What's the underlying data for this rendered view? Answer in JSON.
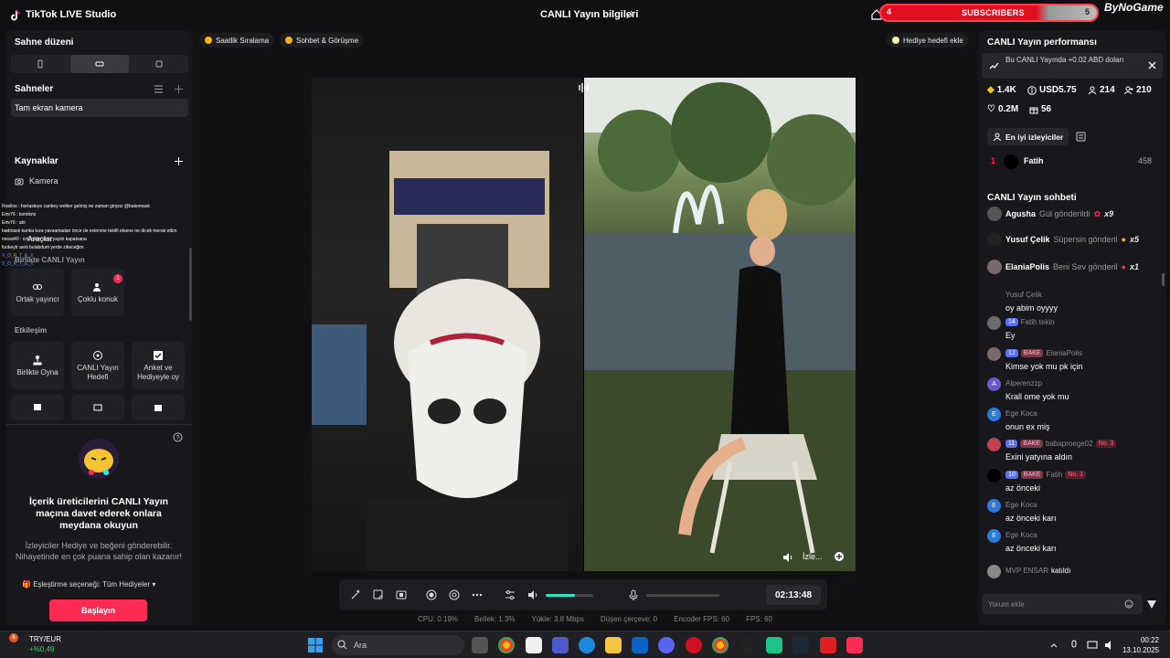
{
  "titlebar": {
    "app_name": "TikTok LIVE Studio",
    "center_title": "CANLI Yayın bilgileri",
    "subscribers_label": "SUBSCRIBERS",
    "subscribers_left": "4",
    "subscribers_right": "5",
    "brand": "ByNoGame"
  },
  "left": {
    "scene_layout_title": "Sahne düzeni",
    "scenes_title": "Sahneler",
    "scene_item": "Tam ekran kamera",
    "sources_title": "Kaynaklar",
    "source_item": "Kamera",
    "overlay_chat": [
      "Roelins : hortasteye canbey wolker gelmiş ne zaman giriyoz @bakemask",
      "Emr76 : komikmi",
      "Emr76 : abi",
      "badmask kanka kıza yavsamadan önce de evlenme teklifi etsene ne dicek merak ettim",
      "messi40 : cok iyisin emir yayini kapatsana",
      "funkeytr aeni bulabdum yerde zikeceğim",
      "V_O_R_T_E_X",
      "V_O_R_T_E_X"
    ],
    "tools_title": "Araçlar",
    "tool_birlikte": "Birlikte CANLI Yayın",
    "tool_partner": "Ortak yayıncı",
    "tool_guests": "Çoklu konuk",
    "guests_badge": "1",
    "interaction_title": "Etkileşim",
    "tool_play": "Birlikte Oyna",
    "tool_goal": "CANLI Yayın Hedefi",
    "tool_poll": "Anket ve Hediyeyle oy",
    "promo_title": "İçerik üreticilerini CANLI Yayın maçına davet ederek onlara meydana okuyun",
    "promo_body": "İzleyiciler Hediye ve beğeni gönderebilir. Nihayetinde en çok puana sahip olan kazanır!",
    "promo_option": "Eşleştirme seçeneği: Tüm Hediyeler",
    "start_button": "Başlayın"
  },
  "center": {
    "chip_hourly": "Saatlik Sıralama",
    "chip_chat": "Sohbet & Görüşme",
    "chip_gift_goal": "Hediye hedefi ekle",
    "watch_label": "İzle...",
    "timer": "02:13:48",
    "volume_level": 0.62,
    "stats": {
      "cpu": "CPU: 0.19%",
      "memory": "Bellek: 1.3%",
      "upload": "Yükle: 3.8 Mbps",
      "dropped": "Düşen çerçeve: 0",
      "encoder_fps": "Encoder FPS: 60",
      "fps": "FPS: 60"
    }
  },
  "right": {
    "perf_title": "CANLI Yayın performansı",
    "perf_note": "Bu CANLI Yayında +0.02 ABD doları",
    "kpi_diamonds": "1.4K",
    "kpi_usd": "USD5.75",
    "kpi_viewers": "214",
    "kpi_followers": "210",
    "kpi_likes": "0.2M",
    "kpi_gifts": "56",
    "top_viewers_btn": "En iyi izleyiciler",
    "rank_no": "1",
    "rank_name": "Fatih",
    "rank_score": "458",
    "chat_title": "CANLI Yayın sohbeti",
    "gifts": [
      {
        "name": "Agusha",
        "text": "Gül gönderildi",
        "count": "x9"
      },
      {
        "name": "Yusuf Çelik",
        "text": "Süpersin gönderil",
        "count": "x5"
      },
      {
        "name": "ElaniaPolis",
        "text": "Beni Sev gönderil",
        "count": "x1"
      }
    ],
    "messages": [
      {
        "name": "Yusuf Çelik",
        "text": "oy abim oyyyy"
      },
      {
        "level": "14",
        "name": "Fatih tekin",
        "text": "Ey"
      },
      {
        "level": "12",
        "tag": "BAKE",
        "name": "ElaniaPolis",
        "text": "Kimse yok mu pk için"
      },
      {
        "name": "Alperenzzp",
        "text": "Krall ome yok mu",
        "initial": "A"
      },
      {
        "name": "Ege Koca",
        "text": "onun ex miş",
        "initial": "E"
      },
      {
        "level": "11",
        "tag": "BAKE",
        "name": "babaproege02",
        "rank": "No. 3",
        "text": "Exini yatyına aldın"
      },
      {
        "level": "10",
        "tag": "BAKE",
        "name": "Fatih",
        "rank": "No. 1",
        "text": "az önceki"
      },
      {
        "name": "Ege Koca",
        "text": "az önceki karı",
        "initial": "E"
      },
      {
        "name": "Ege Koca",
        "text": "az önceki karı",
        "initial": "E"
      }
    ],
    "joined_name": "MVP ENSAR",
    "joined_text": "katıldı",
    "comment_placeholder": "Yorum ekle"
  },
  "taskbar": {
    "stock_name": "TRY/EUR",
    "stock_change": "+%0,49",
    "stock_badge": "6",
    "search_placeholder": "Ara",
    "time": "00:22",
    "date": "13.10.2025"
  },
  "colors": {
    "accent": "#fe2c55",
    "volume": "#2ee6c8",
    "subscriber_bar": "#e01020"
  }
}
